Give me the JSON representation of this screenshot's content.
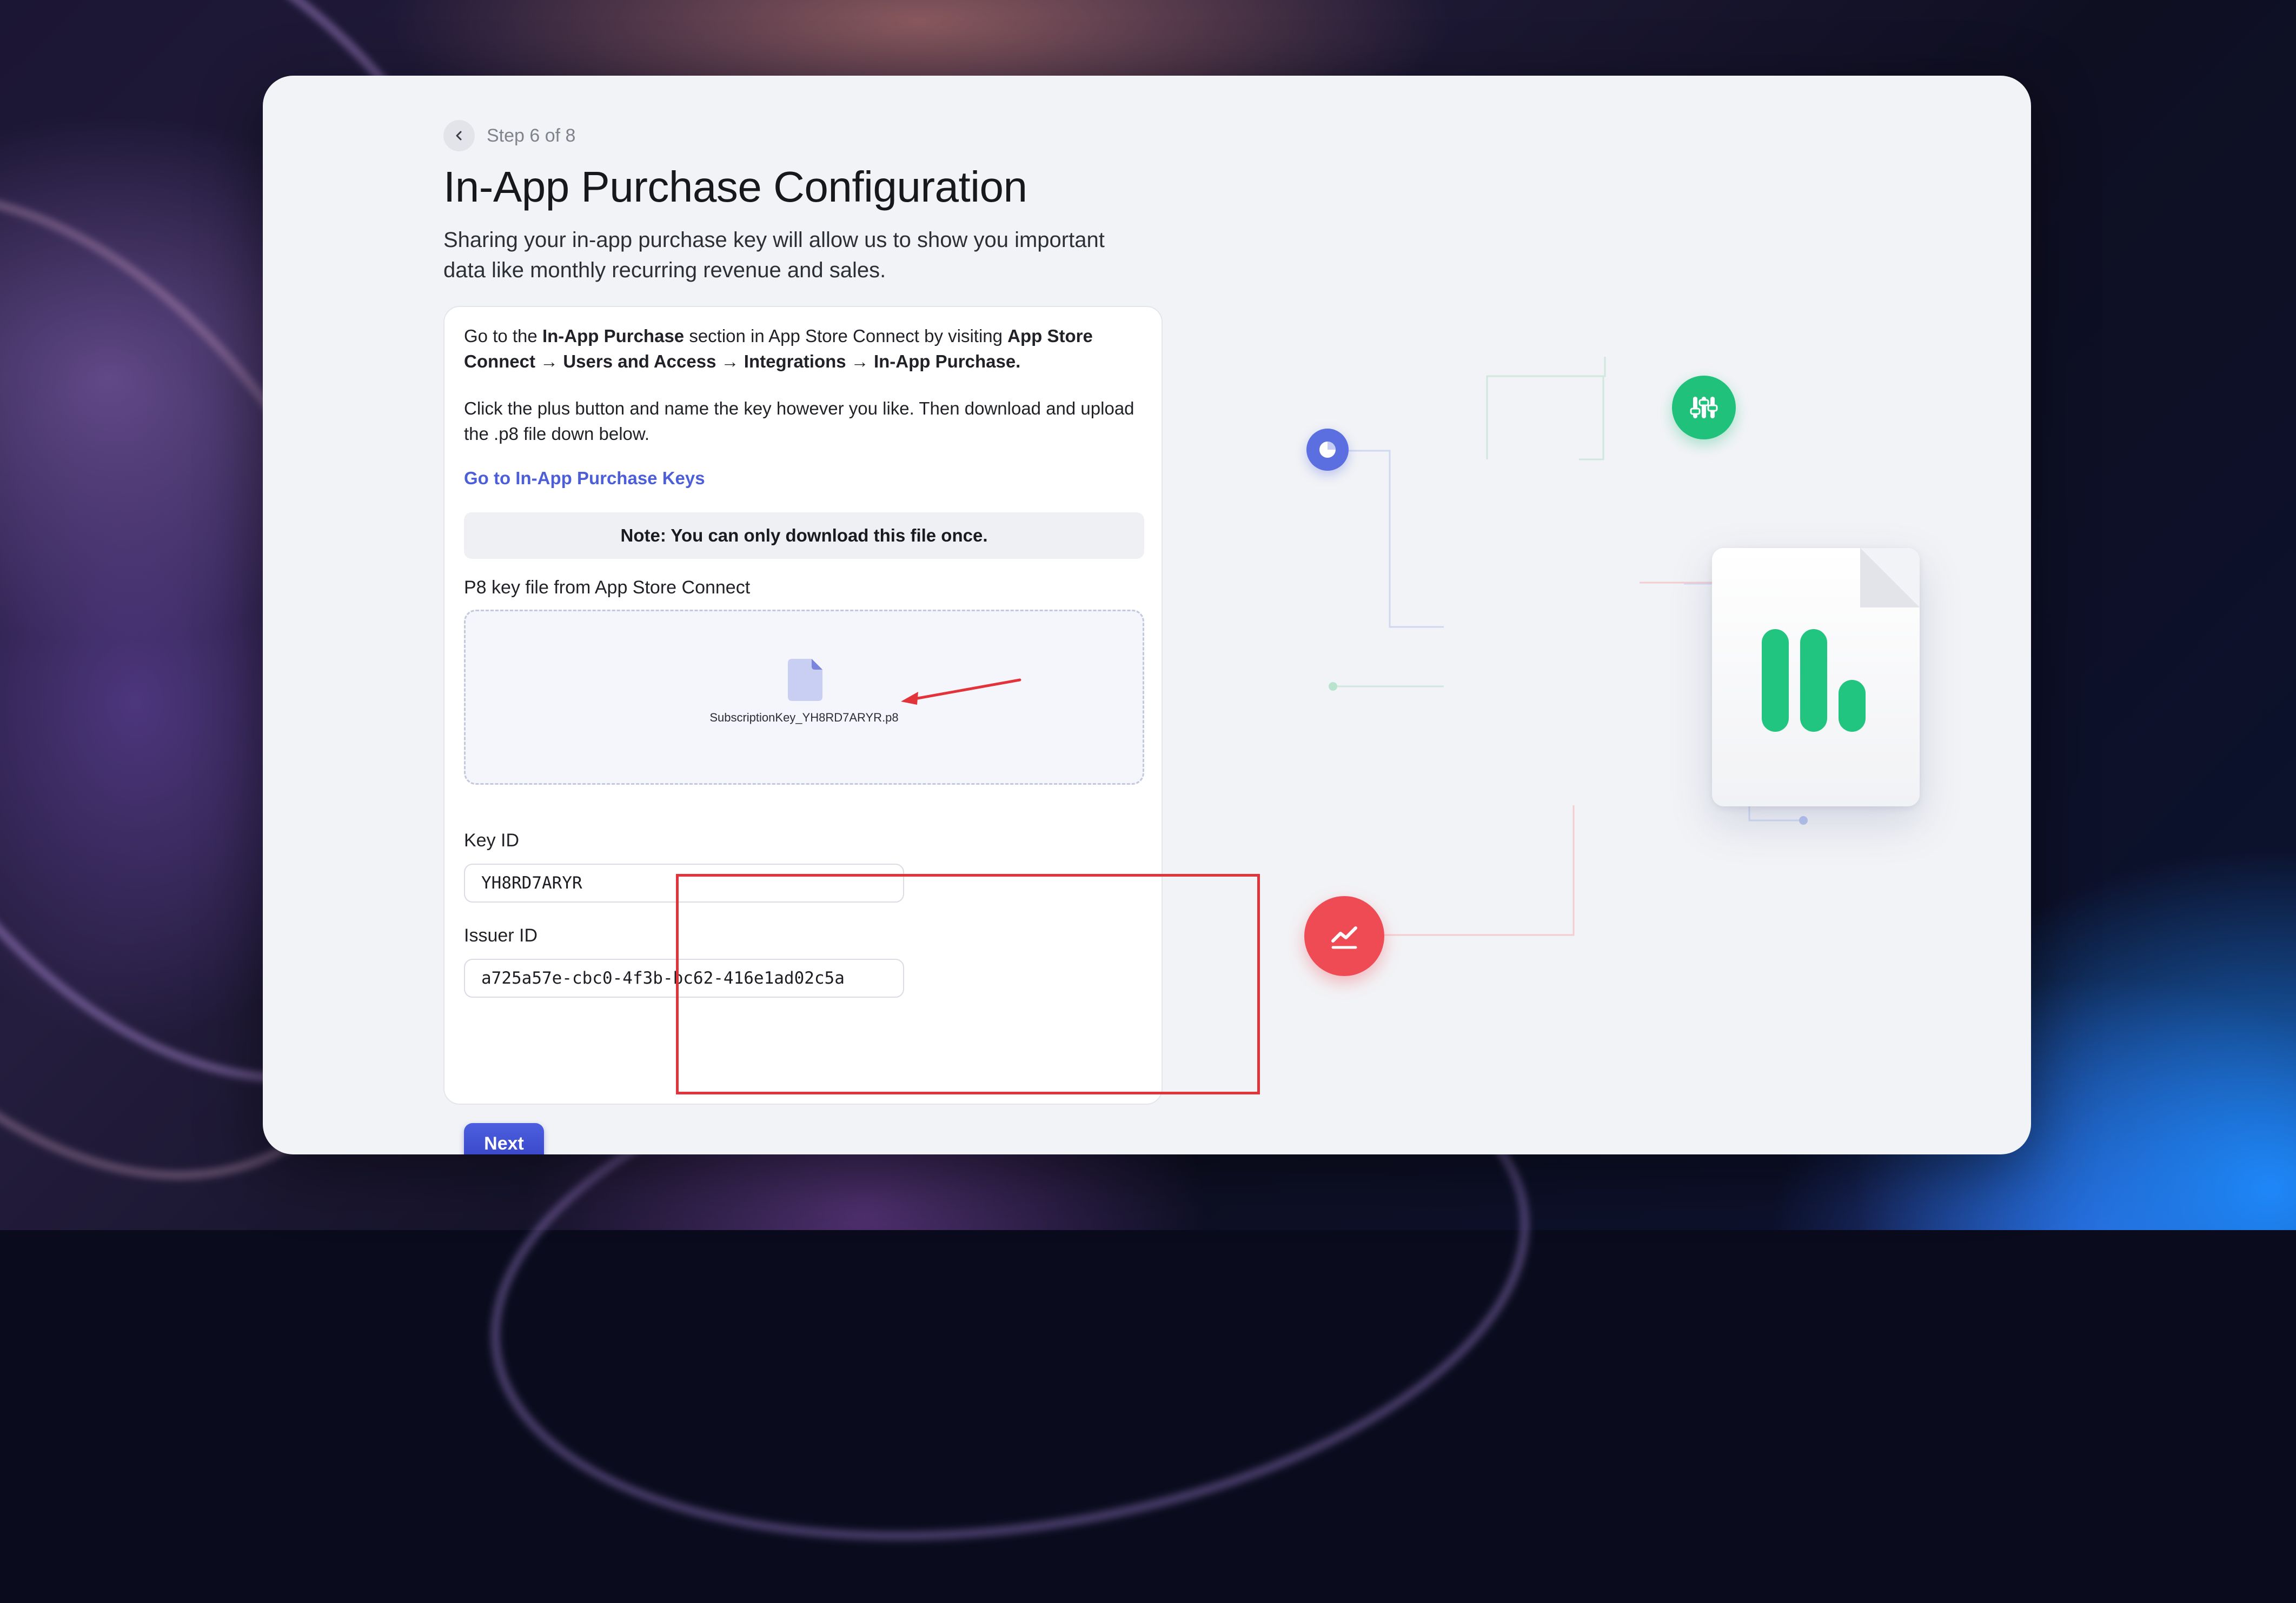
{
  "step": {
    "back_icon": "chevron-left-icon",
    "label": "Step 6 of 8"
  },
  "page": {
    "title": "In-App Purchase Configuration",
    "subtitle": "Sharing your in-app purchase key will allow us to show you important data like monthly recurring revenue and sales."
  },
  "instructions": {
    "p1_prefix": "Go to the ",
    "p1_bold1": "In-App Purchase",
    "p1_mid": " section in App Store Connect by visiting ",
    "p1_bold2": "App Store Connect → Users and Access → Integrations → In-App Purchase.",
    "p2": "Click the plus button and name the key however you like. Then download and upload the .p8 file down below."
  },
  "link": {
    "label": "Go to In-App Purchase Keys"
  },
  "note": "Note: You can only download this file once.",
  "upload": {
    "label": "P8 key file from App Store Connect",
    "file_icon": "document-icon",
    "file_name": "SubscriptionKey_YH8RD7ARYR.p8"
  },
  "key_id": {
    "label": "Key ID",
    "value": "YH8RD7ARYR"
  },
  "issuer_id": {
    "label": "Issuer ID",
    "value": "a725a57e-cbc0-4f3b-bc62-416e1ad02c5a"
  },
  "next_button": "Next",
  "colors": {
    "accent": "#4c5ed8",
    "green": "#22c57f",
    "red_highlight": "#e3333a",
    "purple_dot": "#5b6fe0",
    "red_dot": "#ef4b55"
  },
  "illustration_icons": [
    "pie-chart-icon",
    "filters-icon",
    "bar-chart-icon",
    "trend-line-icon"
  ]
}
